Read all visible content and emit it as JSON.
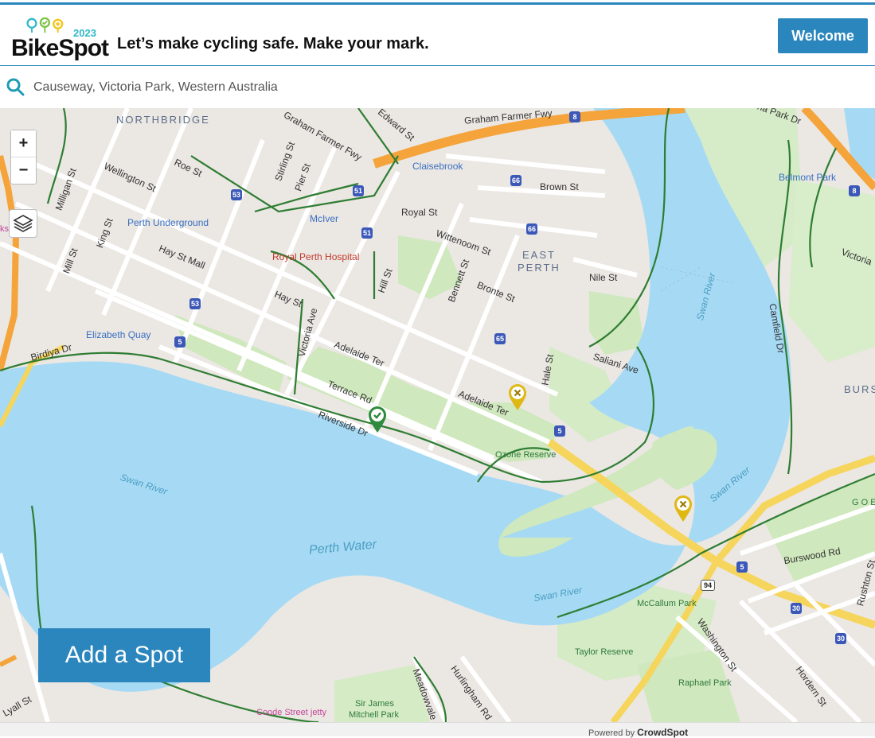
{
  "header": {
    "logo_text": "BikeSpot",
    "logo_year": "2023",
    "tagline": "Let’s make cycling safe. Make your mark.",
    "welcome_label": "Welcome"
  },
  "search": {
    "value": "Causeway, Victoria Park, Western Australia"
  },
  "map": {
    "zoom_in_label": "+",
    "zoom_out_label": "−",
    "districts": [
      "NORTHBRIDGE",
      "EAST",
      "PERTH",
      "BURS"
    ],
    "streets": [
      "Graham Farmer Fwy",
      "Graham Farmer Fwy",
      "Edward St",
      "Wellington St",
      "Roe St",
      "Milligan St",
      "Stirling St",
      "Pier St",
      "Brown St",
      "Royal St",
      "Wittenoom St",
      "Hay St Mall",
      "King St",
      "Mill St",
      "Hay St",
      "Hill St",
      "Bennett St",
      "Bronte St",
      "Nile St",
      "Victoria Ave",
      "Adelaide Ter",
      "Adelaide Ter",
      "Terrace Rd",
      "Riverside Dr",
      "Hale St",
      "Saliani Ave",
      "Birdiya Dr",
      "Camfield Dr",
      "Victoria",
      "na Park Dr",
      "Burswood Rd",
      "Washington St",
      "Rushton St",
      "Hordern St",
      "Hurlingham Rd",
      "Meadowvale",
      "Lyall St"
    ],
    "places_blue": [
      "Claisebrook",
      "Perth Underground",
      "McIver",
      "Elizabeth Quay",
      "Belmont Park"
    ],
    "hospital": "Royal Perth Hospital",
    "parks": [
      "Ozone Reserve",
      "McCallum Park",
      "Taylor Reserve",
      "Raphael Park",
      "Sir James",
      "Mitchell Park",
      "G O Edwards"
    ],
    "water_labels": [
      "Swan River",
      "Swan River",
      "Swan River",
      "Swan River"
    ],
    "water_main": "Perth Water",
    "jetty": "Coode Street jetty",
    "route_shields": [
      "8",
      "66",
      "53",
      "51",
      "51",
      "66",
      "53",
      "5",
      "65",
      "5",
      "5",
      "94",
      "30",
      "30",
      "8"
    ],
    "edge_label": "ks",
    "markers": [
      {
        "type": "approved",
        "color": "#2e8b3d"
      },
      {
        "type": "unsafe",
        "color": "#e0b814"
      },
      {
        "type": "unsafe",
        "color": "#e0b814"
      }
    ]
  },
  "actions": {
    "add_spot_label": "Add a Spot"
  },
  "footer": {
    "powered_prefix": "Powered by",
    "brand": "CrowdSpot"
  },
  "colors": {
    "accent": "#2a86bd",
    "water": "#a6daf4",
    "park": "#c9e8b8",
    "bike_route": "#2e7d32",
    "freeway": "#f4a43b"
  }
}
